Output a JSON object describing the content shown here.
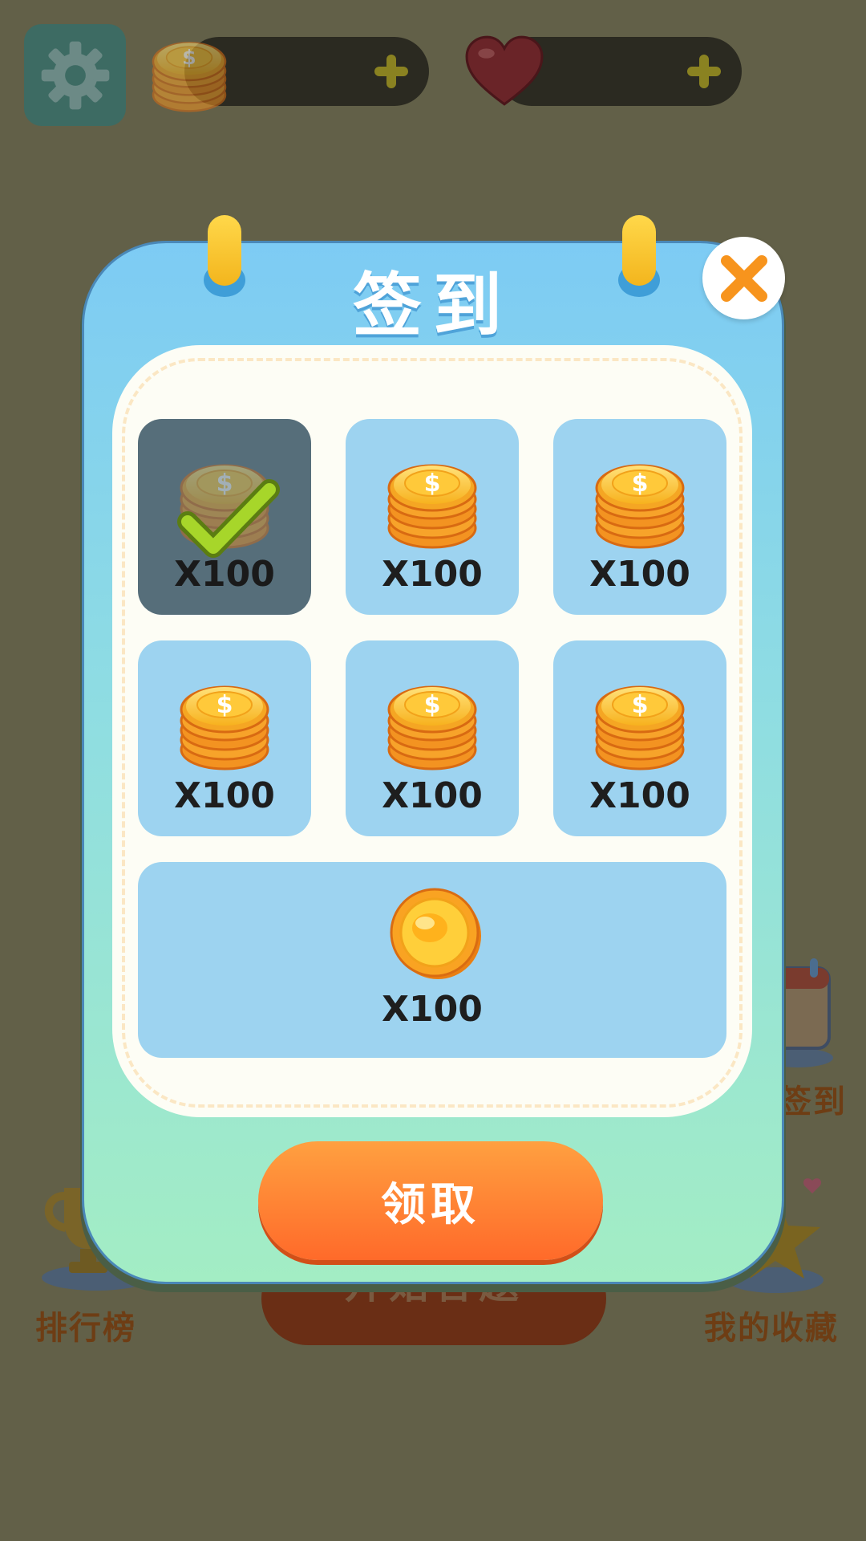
{
  "hud": {
    "settings_icon": "gear-icon",
    "coins_icon": "coin-stack-icon",
    "hearts_icon": "heart-icon",
    "plus_icon": "plus-icon"
  },
  "background": {
    "leaderboard_label": "排行榜",
    "checkin_label": "签到",
    "favorites_label": "我的收藏",
    "start_label": "开始答题"
  },
  "modal": {
    "title": "签到",
    "close_icon": "close-icon",
    "days": [
      {
        "qty": "X100",
        "claimed": true
      },
      {
        "qty": "X100",
        "claimed": false
      },
      {
        "qty": "X100",
        "claimed": false
      },
      {
        "qty": "X100",
        "claimed": false
      },
      {
        "qty": "X100",
        "claimed": false
      },
      {
        "qty": "X100",
        "claimed": false
      },
      {
        "qty": "X100",
        "claimed": false
      }
    ],
    "claim_label": "领取"
  },
  "colors": {
    "overlay_bg": "#626048",
    "modal_top": "#7dcbf4",
    "modal_bottom": "#a3edc4",
    "tile": "#9dd3f0",
    "tile_claimed": "#566e7a",
    "claim_button": "#ff7a30",
    "close_x": "#f7941d"
  }
}
